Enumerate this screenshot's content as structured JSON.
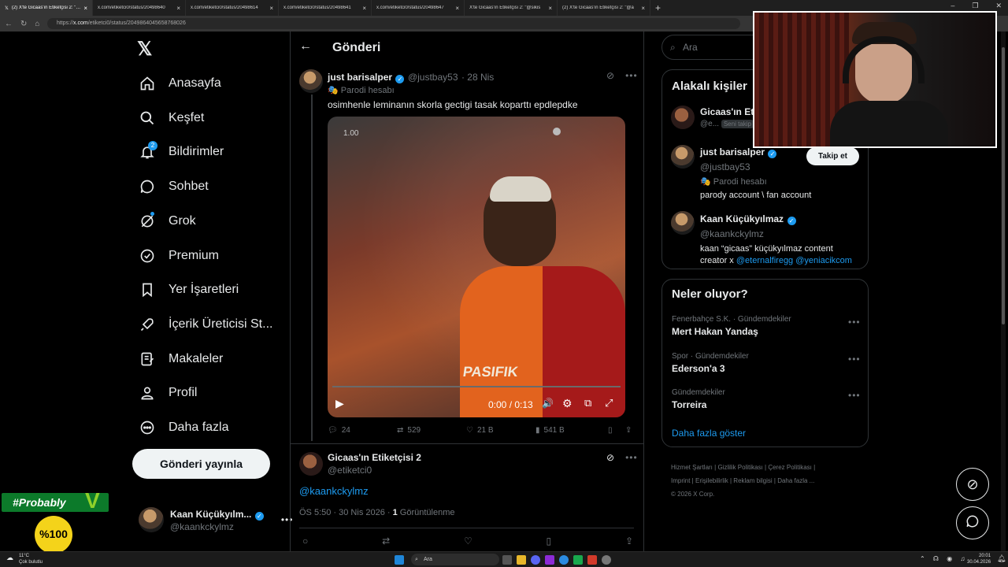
{
  "browser": {
    "tabs": [
      {
        "label": "(2) X'te Gicaas'ın Etiketçisi 2: \"@ja",
        "active": true
      },
      {
        "label": "x.com/etiketci0/status/20498640",
        "active": false
      },
      {
        "label": "x.com/etiketci0/status/20498614",
        "active": false
      },
      {
        "label": "x.com/etiketci0/status/20498641",
        "active": false
      },
      {
        "label": "x.com/etiketci0/status/20498647",
        "active": false
      },
      {
        "label": "X'te Gicaas'ın Etiketçisi 2: \"@sikis",
        "active": false
      },
      {
        "label": "(2) X'te Gicaas'ın Etiketçisi 2: \"@a",
        "active": false
      }
    ],
    "url_prefix": "https://",
    "url_host": "x.com",
    "url_path": "/etiketci0/status/2049864045658768026"
  },
  "nav": {
    "items": [
      {
        "label": "Anasayfa",
        "icon": "home-icon"
      },
      {
        "label": "Keşfet",
        "icon": "search-icon"
      },
      {
        "label": "Bildirimler",
        "icon": "bell-icon",
        "badge": "2"
      },
      {
        "label": "Sohbet",
        "icon": "chat-icon"
      },
      {
        "label": "Grok",
        "icon": "grok-icon"
      },
      {
        "label": "Premium",
        "icon": "verified-badge-icon"
      },
      {
        "label": "Yer İşaretleri",
        "icon": "bookmark-icon"
      },
      {
        "label": "İçerik Üreticisi St...",
        "icon": "rocket-icon"
      },
      {
        "label": "Makaleler",
        "icon": "article-icon"
      },
      {
        "label": "Profil",
        "icon": "person-icon"
      },
      {
        "label": "Daha fazla",
        "icon": "more-circle-icon"
      }
    ],
    "post_button": "Gönderi yayınla",
    "account": {
      "name": "Kaan Küçükyılm...",
      "handle": "@kaankckylmz"
    }
  },
  "header": {
    "title": "Gönderi"
  },
  "tweet": {
    "name": "just barisalper",
    "handle": "@justbay53",
    "date": "· 28 Nis",
    "label": "Parodi hesabı",
    "text": "osimhenle leminanın skorla gectigi tasak koparttı epdlepdke",
    "video": {
      "time": "0:00 / 0:13",
      "speed": "1.00",
      "progress": 0
    },
    "stats": {
      "replies": "24",
      "reposts": "529",
      "likes": "21 B",
      "views": "541 B"
    }
  },
  "reply": {
    "name": "Gicaas'ın Etiketçisi 2",
    "handle": "@etiketci0",
    "mention": "@kaankckylmz",
    "time": "ÖS 5:50 · 30 Nis 2026 · ",
    "view_count": "1",
    "view_label": " Görüntülenme"
  },
  "right": {
    "search_placeholder": "Ara",
    "related": {
      "title": "Alakalı kişiler",
      "people": [
        {
          "name": "Gicaas'ın Eti...",
          "handle": "@e...",
          "tag": "Seni takip"
        },
        {
          "name": "just barisalper",
          "handle": "@justbay53",
          "label": "Parodi hesabı",
          "bio": "parody account \\ fan account",
          "follow": "Takip et"
        },
        {
          "name": "Kaan Küçükyılmaz",
          "handle": "@kaankckylmz",
          "bio_text": "kaan “gicaas” küçükyılmaz content creator x ",
          "bio_link1": "@eternalfiregg",
          "bio_link2": "@yeniacikcom"
        }
      ]
    },
    "trends": {
      "title": "Neler oluyor?",
      "items": [
        {
          "context": "Fenerbahçe S.K. · Gündemdekiler",
          "topic": "Mert Hakan Yandaş"
        },
        {
          "context": "Spor · Gündemdekiler",
          "topic": "Ederson'a 3"
        },
        {
          "context": "Gündemdekiler",
          "topic": "Torreira"
        }
      ],
      "show_more": "Daha fazla göster"
    },
    "footer": {
      "line1": [
        "Hizmet Şartları",
        "Gizlilik Politikası",
        "Çerez Politikası"
      ],
      "line2": [
        "Imprint",
        "Erişilebilirlik",
        "Reklam bilgisi",
        "Daha fazla ..."
      ],
      "copyright": "© 2026 X Corp."
    }
  },
  "overlay": {
    "hashtag": "#Probably",
    "logo_text": "%100"
  },
  "taskbar": {
    "weather_temp": "11°C",
    "weather_desc": "Çok bulutlu",
    "search": "Ara",
    "time": "20:01",
    "date": "30.04.2026"
  },
  "colors": {
    "accent": "#1d9bf0",
    "bg": "#000000",
    "border": "#2f3336",
    "gray": "#71767b"
  }
}
